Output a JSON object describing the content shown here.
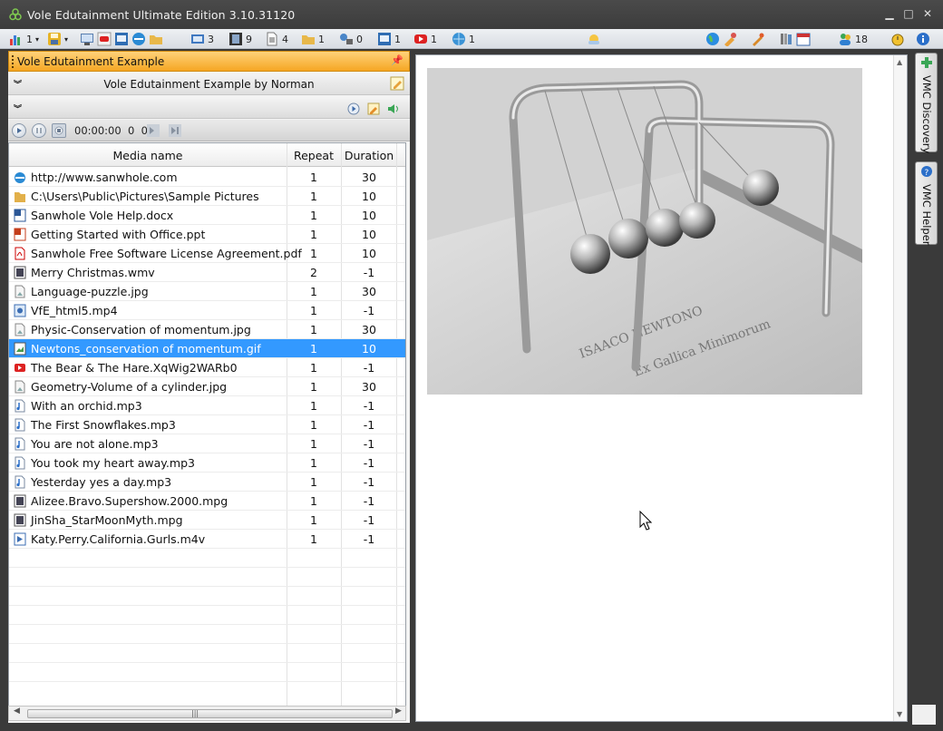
{
  "window": {
    "title": "Vole Edutainment  Ultimate Edition  3.10.31120",
    "minimize_glyph": "▁",
    "maximize_glyph": "□",
    "close_glyph": "✕"
  },
  "toolbar": {
    "left_counts": {
      "charts": "1",
      "slides": "3",
      "videos": "9",
      "documents": "4",
      "folders": "1",
      "network": "0",
      "presentations": "1",
      "youtube": "1",
      "web": "1"
    },
    "right_counts": {
      "people": "18"
    }
  },
  "panel": {
    "document_title": "Vole Edutainment Example",
    "pin_glyph": "📌",
    "subtitle": "Vole Edutainment Example by Norman"
  },
  "player": {
    "time": "00:00:00",
    "counter_a": "0",
    "counter_b": "0"
  },
  "table": {
    "columns": [
      "Media name",
      "Repeat",
      "Duration"
    ],
    "rows": [
      {
        "name": "http://www.sanwhole.com",
        "repeat": "1",
        "duration": "30",
        "type": "web"
      },
      {
        "name": "C:\\Users\\Public\\Pictures\\Sample Pictures",
        "repeat": "1",
        "duration": "10",
        "type": "folder"
      },
      {
        "name": "Sanwhole Vole Help.docx",
        "repeat": "1",
        "duration": "10",
        "type": "word"
      },
      {
        "name": "Getting Started with Office.ppt",
        "repeat": "1",
        "duration": "10",
        "type": "ppt"
      },
      {
        "name": "Sanwhole Free Software License Agreement.pdf",
        "repeat": "1",
        "duration": "10",
        "type": "pdf"
      },
      {
        "name": "Merry Christmas.wmv",
        "repeat": "2",
        "duration": "-1",
        "type": "video"
      },
      {
        "name": "Language-puzzle.jpg",
        "repeat": "1",
        "duration": "30",
        "type": "image"
      },
      {
        "name": "VfE_html5.mp4",
        "repeat": "1",
        "duration": "-1",
        "type": "html5"
      },
      {
        "name": "Physic-Conservation of momentum.jpg",
        "repeat": "1",
        "duration": "30",
        "type": "image"
      },
      {
        "name": "Newtons_conservation of momentum.gif",
        "repeat": "1",
        "duration": "10",
        "type": "gif"
      },
      {
        "name": "The Bear & The Hare.XqWig2WARb0",
        "repeat": "1",
        "duration": "-1",
        "type": "youtube"
      },
      {
        "name": "Geometry-Volume of a cylinder.jpg",
        "repeat": "1",
        "duration": "30",
        "type": "image"
      },
      {
        "name": "With an orchid.mp3",
        "repeat": "1",
        "duration": "-1",
        "type": "audio"
      },
      {
        "name": "The First Snowflakes.mp3",
        "repeat": "1",
        "duration": "-1",
        "type": "audio"
      },
      {
        "name": "You are not alone.mp3",
        "repeat": "1",
        "duration": "-1",
        "type": "audio"
      },
      {
        "name": "You took my heart away.mp3",
        "repeat": "1",
        "duration": "-1",
        "type": "audio"
      },
      {
        "name": "Yesterday yes a day.mp3",
        "repeat": "1",
        "duration": "-1",
        "type": "audio"
      },
      {
        "name": "Alizee.Bravo.Supershow.2000.mpg",
        "repeat": "1",
        "duration": "-1",
        "type": "video"
      },
      {
        "name": "JinSha_StarMoonMyth.mpg",
        "repeat": "1",
        "duration": "-1",
        "type": "video"
      },
      {
        "name": "Katy.Perry.California.Gurls.m4v",
        "repeat": "1",
        "duration": "-1",
        "type": "m4v"
      }
    ],
    "selected_index": 9,
    "empty_rows": 7
  },
  "scrollbar": {
    "grip": "|||"
  },
  "dock": {
    "discovery_label": "VMC Discovery",
    "helper_label": "VMC Helper"
  },
  "colors": {
    "accent_orange": "#f5a623",
    "selection_blue": "#3399ff",
    "chrome_dark": "#3a3a3a"
  }
}
